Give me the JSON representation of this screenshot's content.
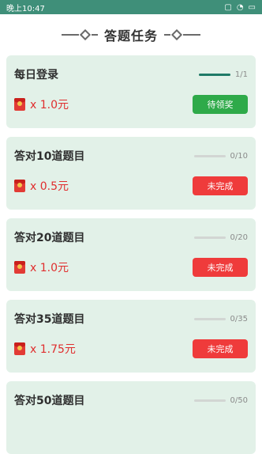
{
  "status_bar": {
    "time": "晚上10:47"
  },
  "header": {
    "title": "答题任务"
  },
  "tasks": [
    {
      "name": "每日登录",
      "progress_text": "1/1",
      "progress_fraction": 1.0,
      "reward": "x 1.0元",
      "button": "待领奖",
      "button_state": "claim"
    },
    {
      "name": "答对10道题目",
      "progress_text": "0/10",
      "progress_fraction": 0.0,
      "reward": "x 0.5元",
      "button": "未完成",
      "button_state": "undone"
    },
    {
      "name": "答对20道题目",
      "progress_text": "0/20",
      "progress_fraction": 0.0,
      "reward": "x 1.0元",
      "button": "未完成",
      "button_state": "undone"
    },
    {
      "name": "答对35道题目",
      "progress_text": "0/35",
      "progress_fraction": 0.0,
      "reward": "x 1.75元",
      "button": "未完成",
      "button_state": "undone"
    },
    {
      "name": "答对50道题目",
      "progress_text": "0/50",
      "progress_fraction": 0.0,
      "reward": "",
      "button": "",
      "button_state": "undone"
    }
  ],
  "colors": {
    "status_bar": "#3f8f79",
    "card": "#e2f1e8",
    "claim": "#2eaa49",
    "undone": "#ef3b3b",
    "reward": "#e02e2e"
  },
  "icons": {
    "reward_icon": "red-envelope-icon"
  }
}
